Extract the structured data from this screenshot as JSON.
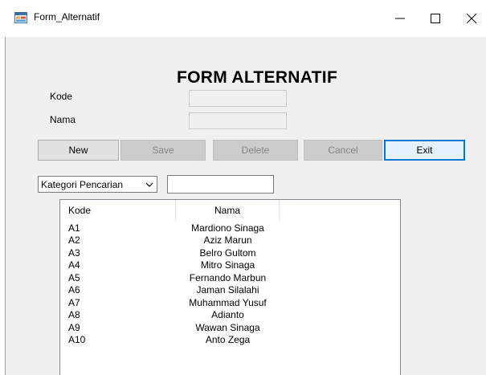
{
  "window": {
    "title": "Form_Alternatif"
  },
  "form": {
    "heading": "FORM ALTERNATIF",
    "kode_label": "Kode",
    "nama_label": "Nama",
    "kode_value": "",
    "nama_value": ""
  },
  "buttons": {
    "new": "New",
    "save": "Save",
    "delete": "Delete",
    "cancel": "Cancel",
    "exit": "Exit"
  },
  "search": {
    "category": "Kategori Pencarian",
    "query": ""
  },
  "table": {
    "columns": [
      "Kode",
      "Nama"
    ],
    "rows": [
      {
        "kode": "A1",
        "nama": "Mardiono Sinaga"
      },
      {
        "kode": "A2",
        "nama": "Aziz Marun"
      },
      {
        "kode": "A3",
        "nama": "Belro Gultom"
      },
      {
        "kode": "A4",
        "nama": "Mitro Sinaga"
      },
      {
        "kode": "A5",
        "nama": "Fernando Marbun"
      },
      {
        "kode": "A6",
        "nama": "Jaman Silalahi"
      },
      {
        "kode": "A7",
        "nama": "Muhammad Yusuf"
      },
      {
        "kode": "A8",
        "nama": "Adianto"
      },
      {
        "kode": "A9",
        "nama": "Wawan Sinaga"
      },
      {
        "kode": "A10",
        "nama": "Anto Zega"
      }
    ]
  },
  "icons": {
    "app": "form-icon",
    "minimize": "minimize-icon",
    "maximize": "maximize-icon",
    "close": "close-icon",
    "dropdown": "chevron-down-icon"
  },
  "colors": {
    "client_bg": "#f0f0f0",
    "focus_border": "#0078d7",
    "button_bg": "#e1e1e1",
    "disabled_button_bg": "#cccccc"
  }
}
